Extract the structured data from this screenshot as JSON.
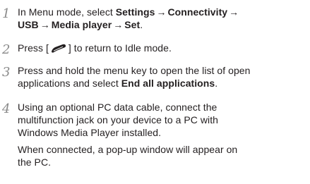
{
  "steps": [
    {
      "number": "1",
      "prefix": "In Menu mode, select ",
      "path": [
        "Settings",
        "Connectivity",
        "USB",
        "Media player",
        "Set"
      ],
      "arrow": "→",
      "suffix": "."
    },
    {
      "number": "2",
      "before": "Press [",
      "key_icon": "end-call-key-icon",
      "after": "] to return to Idle mode."
    },
    {
      "number": "3",
      "line1": "Press and hold the menu key to open the list of open",
      "line2_prefix": "applications and select ",
      "line2_bold": "End all applications",
      "line2_suffix": "."
    },
    {
      "number": "4",
      "lines": [
        "Using an optional PC data cable, connect the",
        "multifunction jack on your device to a PC with",
        "Windows Media Player installed."
      ],
      "note_lines": [
        "When connected, a pop-up window will appear on",
        "the PC."
      ]
    }
  ]
}
